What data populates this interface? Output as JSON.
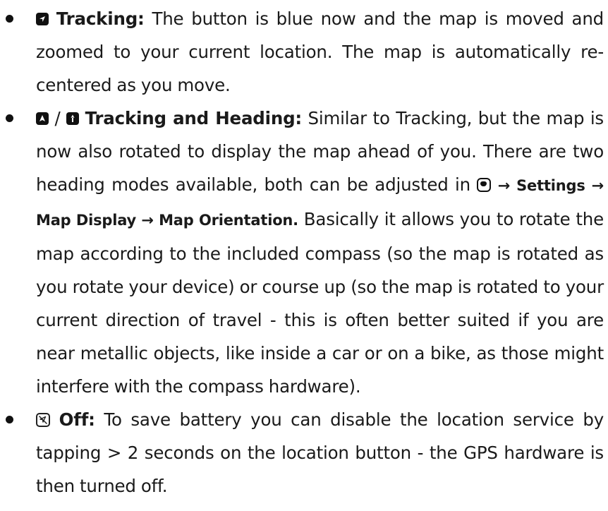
{
  "items": [
    {
      "icon": "tracking-icon",
      "term": "Tracking:",
      "text": " The button is blue now and the map is moved and zoomed to your current location. The map is automatically re-centered as you move."
    },
    {
      "icon": "tracking-heading-icons",
      "separator": " / ",
      "term": "Tracking and Heading:",
      "text_before_menu": " Similar to Tracking, but the map is now also rotated to display the map ahead of you.  There are two heading modes available, both can be adjusted in ",
      "menu_icon": "menu-icon",
      "menu_path": " → Settings → Map Display → Map Orientation.",
      "text_after_menu": " Basically it allows you to rotate the map according to the included compass (so the map is rotated as you rotate your device) or course up (so the map is rotated to your current direction of travel - this is often better suited if you are near metallic objects, like inside a car or on a bike, as those might interfere with the compass hardware)."
    },
    {
      "icon": "location-off-icon",
      "term": "Off:",
      "text": " To save battery you can disable the location service by tapping > 2 seconds on the location button - the GPS hard­ware is then turned off."
    }
  ]
}
